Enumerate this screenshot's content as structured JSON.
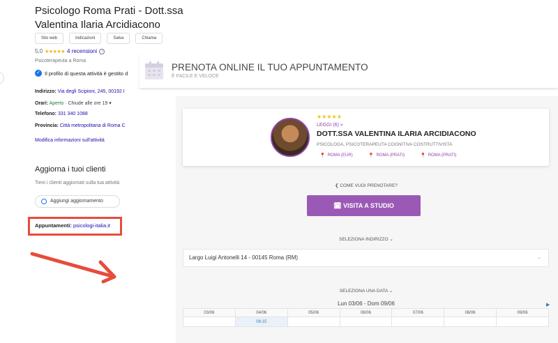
{
  "google": {
    "title": "Psicologo Roma Prati - Dott.ssa Valentina Ilaria Arcidiacono",
    "buttons": [
      "Sito web",
      "Indicazioni",
      "Salva",
      "Chiama"
    ],
    "rating": "5,0",
    "stars": "★★★★★",
    "reviews": "4 recensioni",
    "category": "Psicoterapeuta a Roma",
    "claim": "Il profilo di questa attività è gestito d",
    "address_label": "Indirizzo:",
    "address_value": "Via degli Scipioni, 245, 00192 I",
    "hours_label": "Orari:",
    "hours_open": "Aperto",
    "hours_value": "· Chiude alle ore 19 ▾",
    "phone_label": "Telefono:",
    "phone_value": "331 340 1088",
    "province_label": "Provincia:",
    "province_value": "Città metropolitana di Roma C",
    "edit_link": "Modifica informazioni sull'attività",
    "update_title": "Aggiorna i tuoi clienti",
    "update_sub": "Tieni i clienti aggiornati sulla tua attività",
    "add_update": "Aggiungi aggiornamento",
    "appointments_label": "Appuntamenti:",
    "appointments_value": "psicologi-italia.it"
  },
  "booking": {
    "header_title": "PRENOTA ONLINE IL TUO APPUNTAMENTO",
    "header_sub": "È FACILE E VELOCE",
    "stars": "★★★★★",
    "reviews_link": "LEGGI (6) »",
    "doctor_name": "DOTT.SSA VALENTINA ILARIA ARCIDIACONO",
    "specialty": "PSICOLOGA, PSICOTERAPEUTA COGNITIVA COSTRUTTIVISTA",
    "locations": [
      "ROMA (EUR)",
      "ROMA (PRATI)",
      "ROMA (PRATI)"
    ],
    "how_label": "❮ COME VUOI PRENOTARE?",
    "visit_button": "🗓 VISITA A STUDIO",
    "select_address_label": "SELEZIONA INDIRIZZO ⌄",
    "address_value": "Largo Luigi Antonelli 14 - 00145 Roma (RM)",
    "select_date_label": "SELEZIONA UNA DATA ⌄",
    "week_label": "Lun 03/06 - Dom 09/06",
    "days": [
      "03/06",
      "04/06",
      "05/06",
      "06/06",
      "07/06",
      "08/06",
      "09/06"
    ],
    "slots": [
      "",
      "08:15",
      "",
      "",
      "",
      "",
      ""
    ]
  },
  "colors": {
    "accent": "#9b59b6",
    "highlight_border": "#e74c3c",
    "arrow": "#e74c3c",
    "google_link": "#1a0dab"
  }
}
